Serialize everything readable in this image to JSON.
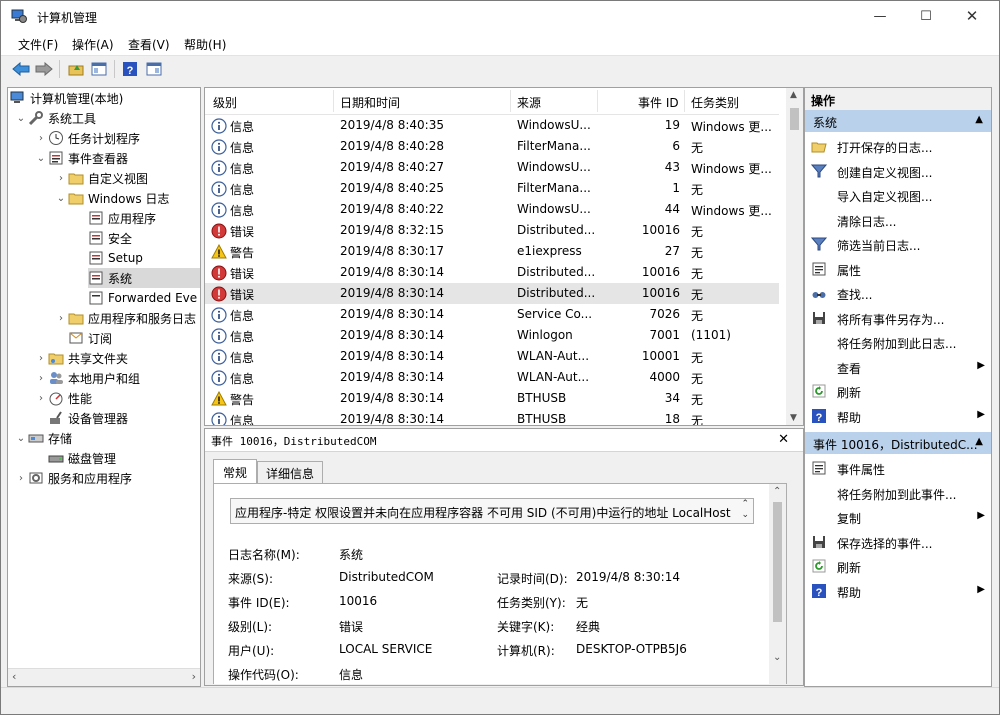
{
  "window": {
    "title": "计算机管理"
  },
  "menu": [
    "文件(F)",
    "操作(A)",
    "查看(V)",
    "帮助(H)"
  ],
  "tree": {
    "root": "计算机管理(本地)",
    "system_tools": "系统工具",
    "task_scheduler": "任务计划程序",
    "event_viewer": "事件查看器",
    "custom_views": "自定义视图",
    "windows_logs": "Windows 日志",
    "application": "应用程序",
    "security": "安全",
    "setup": "Setup",
    "system": "系统",
    "forwarded": "Forwarded Eve",
    "apps_services": "应用程序和服务日志",
    "subscriptions": "订阅",
    "shared_folders": "共享文件夹",
    "local_users": "本地用户和组",
    "performance": "性能",
    "device_manager": "设备管理器",
    "storage": "存储",
    "disk_management": "磁盘管理",
    "services_apps": "服务和应用程序"
  },
  "list": {
    "columns": [
      "级别",
      "日期和时间",
      "来源",
      "事件 ID",
      "任务类别"
    ],
    "rows": [
      {
        "level": "信息",
        "type": "info",
        "date": "2019/4/8 8:40:35",
        "source": "WindowsU...",
        "id": "19",
        "cat": "Windows 更..."
      },
      {
        "level": "信息",
        "type": "info",
        "date": "2019/4/8 8:40:28",
        "source": "FilterMana...",
        "id": "6",
        "cat": "无"
      },
      {
        "level": "信息",
        "type": "info",
        "date": "2019/4/8 8:40:27",
        "source": "WindowsU...",
        "id": "43",
        "cat": "Windows 更..."
      },
      {
        "level": "信息",
        "type": "info",
        "date": "2019/4/8 8:40:25",
        "source": "FilterMana...",
        "id": "1",
        "cat": "无"
      },
      {
        "level": "信息",
        "type": "info",
        "date": "2019/4/8 8:40:22",
        "source": "WindowsU...",
        "id": "44",
        "cat": "Windows 更..."
      },
      {
        "level": "错误",
        "type": "error",
        "date": "2019/4/8 8:32:15",
        "source": "Distributed...",
        "id": "10016",
        "cat": "无"
      },
      {
        "level": "警告",
        "type": "warn",
        "date": "2019/4/8 8:30:17",
        "source": "e1iexpress",
        "id": "27",
        "cat": "无"
      },
      {
        "level": "错误",
        "type": "error",
        "date": "2019/4/8 8:30:14",
        "source": "Distributed...",
        "id": "10016",
        "cat": "无"
      },
      {
        "level": "错误",
        "type": "error",
        "date": "2019/4/8 8:30:14",
        "source": "Distributed...",
        "id": "10016",
        "cat": "无",
        "selected": true
      },
      {
        "level": "信息",
        "type": "info",
        "date": "2019/4/8 8:30:14",
        "source": "Service Co...",
        "id": "7026",
        "cat": "无"
      },
      {
        "level": "信息",
        "type": "info",
        "date": "2019/4/8 8:30:14",
        "source": "Winlogon",
        "id": "7001",
        "cat": "(1101)"
      },
      {
        "level": "信息",
        "type": "info",
        "date": "2019/4/8 8:30:14",
        "source": "WLAN-Aut...",
        "id": "10001",
        "cat": "无"
      },
      {
        "level": "信息",
        "type": "info",
        "date": "2019/4/8 8:30:14",
        "source": "WLAN-Aut...",
        "id": "4000",
        "cat": "无"
      },
      {
        "level": "警告",
        "type": "warn",
        "date": "2019/4/8 8:30:14",
        "source": "BTHUSB",
        "id": "34",
        "cat": "无"
      },
      {
        "level": "信息",
        "type": "info",
        "date": "2019/4/8 8:30:14",
        "source": "BTHUSB",
        "id": "18",
        "cat": "无"
      }
    ]
  },
  "detail": {
    "header": "事件 10016，DistributedCOM",
    "tabs": [
      "常规",
      "详细信息"
    ],
    "message": "应用程序-特定 权限设置并未向在应用程序容器 不可用 SID (不可用)中运行的地址 LocalHost",
    "fields": {
      "log_name_label": "日志名称(M):",
      "log_name": "系统",
      "source_label": "来源(S):",
      "source": "DistributedCOM",
      "logged_label": "记录时间(D):",
      "logged": "2019/4/8 8:30:14",
      "event_id_label": "事件 ID(E):",
      "event_id": "10016",
      "task_label": "任务类别(Y):",
      "task": "无",
      "level_label": "级别(L):",
      "level": "错误",
      "keywords_label": "关键字(K):",
      "keywords": "经典",
      "user_label": "用户(U):",
      "user": "LOCAL SERVICE",
      "computer_label": "计算机(R):",
      "computer": "DESKTOP-OTPB5J6",
      "opcode_label": "操作代码(O):",
      "opcode": "信息"
    }
  },
  "actions": {
    "header": "操作",
    "group1": "系统",
    "items1": [
      "打开保存的日志...",
      "创建自定义视图...",
      "导入自定义视图...",
      "清除日志...",
      "筛选当前日志...",
      "属性",
      "查找...",
      "将所有事件另存为...",
      "将任务附加到此日志...",
      "查看",
      "刷新",
      "帮助"
    ],
    "group2": "事件 10016，DistributedC...",
    "items2": [
      "事件属性",
      "将任务附加到此事件...",
      "复制",
      "保存选择的事件...",
      "刷新",
      "帮助"
    ]
  }
}
